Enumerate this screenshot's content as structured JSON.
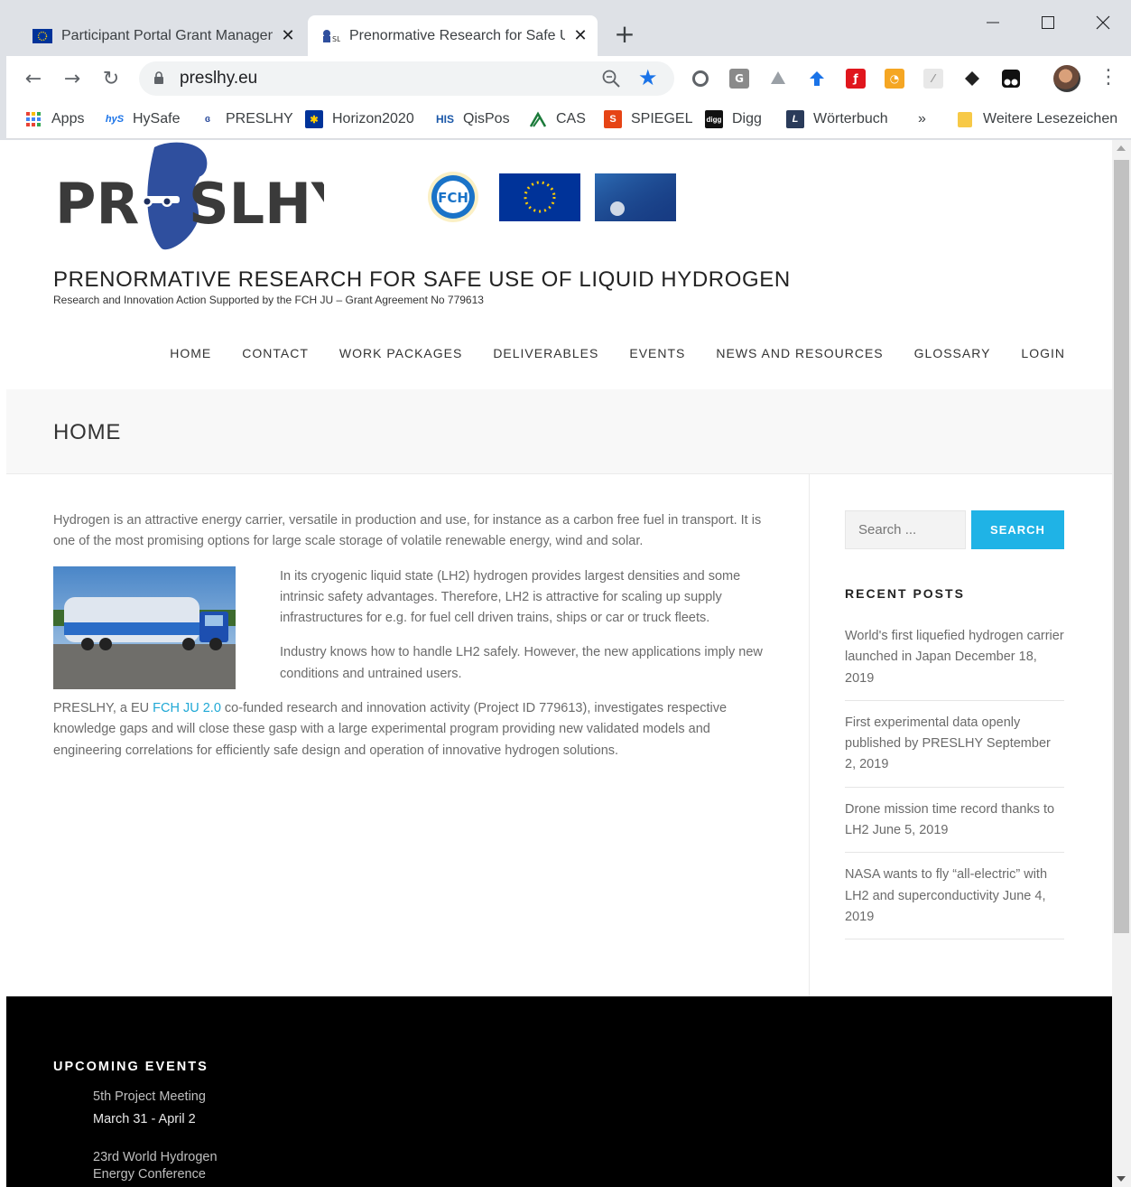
{
  "browser": {
    "tabs": [
      {
        "title": "Participant Portal Grant Managem",
        "active": false
      },
      {
        "title": "Prenormative Research for Safe U",
        "active": true
      }
    ],
    "url": "preslhy.eu",
    "bookmarks": [
      {
        "label": "Apps",
        "icon": "apps-grid-icon"
      },
      {
        "label": "HySafe",
        "icon": "hysafe-icon"
      },
      {
        "label": "PRESLHY",
        "icon": "preslhy-icon"
      },
      {
        "label": "Horizon2020",
        "icon": "eu-flag-icon"
      },
      {
        "label": "QisPos",
        "icon": "his-icon"
      },
      {
        "label": "CAS",
        "icon": "cas-icon"
      },
      {
        "label": "SPIEGEL",
        "icon": "spiegel-icon"
      },
      {
        "label": "Digg",
        "icon": "digg-icon"
      },
      {
        "label": "Wörterbuch",
        "icon": "dictionary-icon"
      }
    ],
    "bookmarks_overflow": "»",
    "other_bookmarks": "Weitere Lesezeichen"
  },
  "site": {
    "logo_text": "PRESLHY",
    "title": "PRENORMATIVE RESEARCH FOR SAFE USE OF LIQUID HYDROGEN",
    "description": "Research and Innovation Action Supported by the FCH JU – Grant Agreement No 779613",
    "partner_logo_text": "FCH",
    "nav": [
      "HOME",
      "CONTACT",
      "WORK PACKAGES",
      "DELIVERABLES",
      "EVENTS",
      "NEWS AND RESOURCES",
      "GLOSSARY",
      "LOGIN"
    ]
  },
  "page": {
    "title": "HOME",
    "paragraphs": {
      "p1": "Hydrogen is an attractive energy carrier, versatile in production and use, for instance as a carbon free fuel in transport. It is one of the most promising options for large scale storage of volatile renewable energy, wind and solar.",
      "p2": "In its cryogenic liquid state (LH2)  hydrogen provides largest densities and some intrinsic safety advantages. Therefore,  LH2 is attractive for scaling up supply infrastructures for e.g. for fuel cell driven trains, ships or car or truck fleets.",
      "p3": "Industry knows how to handle LH2 safely. However, the new applications imply new conditions and untrained users.",
      "p4_before": "PRESLHY, a EU ",
      "p4_link": "FCH JU 2.0",
      "p4_after": " co-funded research and innovation activity (Project ID 779613), investigates respective knowledge gaps and will close these gasp with a large experimental program providing new validated models and engineering correlations for efficiently safe design and operation of innovative hydrogen solutions."
    }
  },
  "sidebar": {
    "search_placeholder": "Search ...",
    "search_button": "SEARCH",
    "recent_title": "RECENT POSTS",
    "recent_posts": [
      "World's first liquefied hydrogen carrier launched in Japan December 18, 2019",
      "First experimental data openly published by PRESLHY September 2, 2019",
      "Drone mission time record thanks to LH2 June 5, 2019",
      "NASA wants to fly “all-electric” with LH2 and superconductivity June 4, 2019"
    ]
  },
  "footer": {
    "events_title": "UPCOMING EVENTS",
    "events": [
      {
        "name": "5th Project Meeting",
        "date": "March 31 - April 2"
      },
      {
        "name": "23rd World Hydrogen Energy Conference",
        "date": ""
      }
    ]
  },
  "colors": {
    "accent": "#1fb3e6",
    "link": "#1fa8d5",
    "footer_bg": "#000000",
    "logo_blue": "#2f4f9e"
  }
}
